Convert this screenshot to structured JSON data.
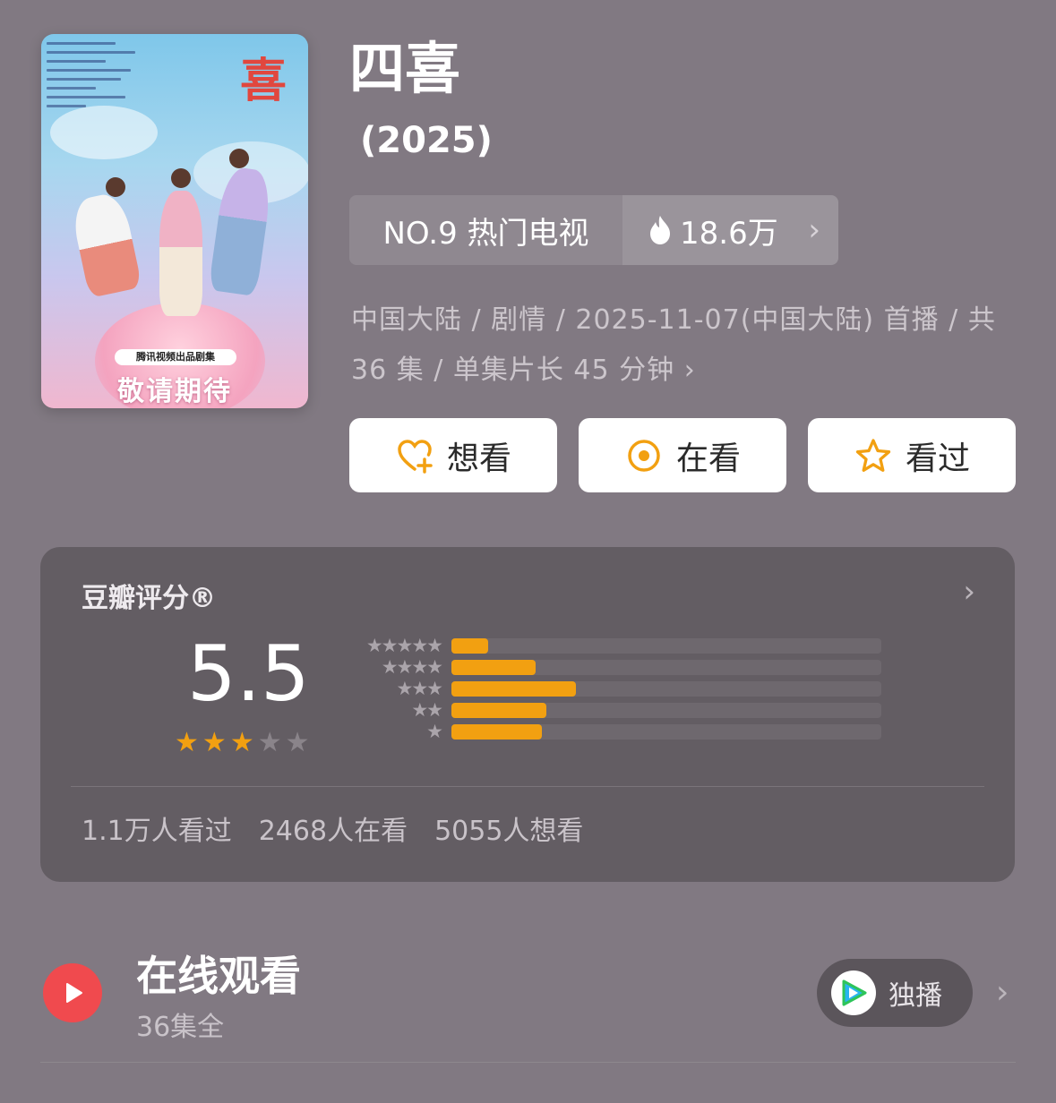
{
  "poster": {
    "title_char": "喜",
    "tag": "腾讯视频出品剧集",
    "banner": "敬请期待"
  },
  "header": {
    "title": "四喜",
    "year": "(2025)"
  },
  "rank": {
    "label": "NO.9 热门电视",
    "heat": "18.6万"
  },
  "meta": {
    "text": "中国大陆 / 剧情 / 2025-11-07(中国大陆) 首播 / 共 36 集 / 单集片长 45 分钟"
  },
  "actions": {
    "want": "想看",
    "watching": "在看",
    "watched": "看过"
  },
  "rating": {
    "heading": "豆瓣评分®",
    "score": "5.5",
    "stars_filled": 3,
    "stars_total": 5,
    "distribution": [
      {
        "stars": "★★★★★",
        "fraction": 0.085
      },
      {
        "stars": "★★★★",
        "fraction": 0.195
      },
      {
        "stars": "★★★",
        "fraction": 0.29
      },
      {
        "stars": "★★",
        "fraction": 0.22
      },
      {
        "stars": "★",
        "fraction": 0.21
      }
    ],
    "counts": {
      "watched": "1.1万人看过",
      "watching": "2468人在看",
      "want": "5055人想看"
    }
  },
  "online": {
    "title": "在线观看",
    "episodes": "36集全",
    "exclusive": "独播"
  },
  "colors": {
    "background": "#817982",
    "accent_orange": "#f2a011",
    "play_red": "#f04a4e"
  },
  "icons": {
    "want": "heart-plus-icon",
    "watching": "target-icon",
    "watched": "star-outline-icon",
    "heat": "flame-icon",
    "play": "play-icon",
    "platform": "tencent-video-logo"
  }
}
